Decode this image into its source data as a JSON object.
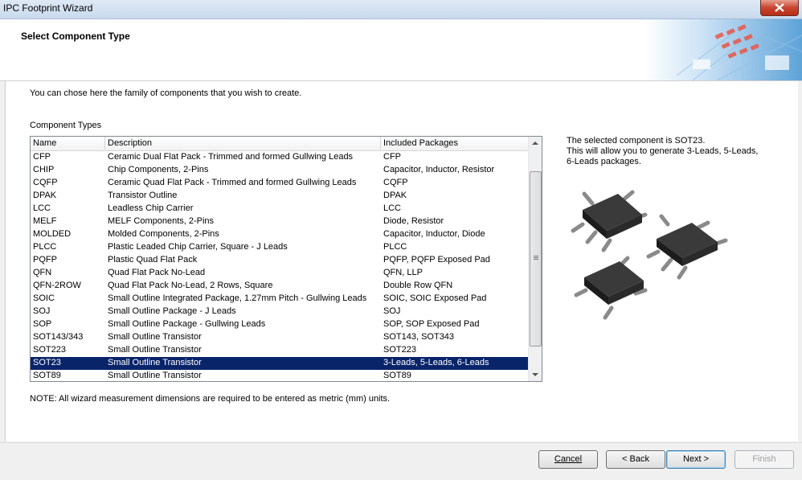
{
  "window": {
    "title": "IPC Footprint Wizard"
  },
  "header": {
    "title": "Select Component Type"
  },
  "intro_text": "You can chose here the family of components that you wish to create.",
  "list_label": "Component Types",
  "columns": [
    "Name",
    "Description",
    "Included Packages"
  ],
  "rows": [
    {
      "name": "CFP",
      "description": "Ceramic Dual Flat Pack - Trimmed and formed Gullwing Leads",
      "packages": "CFP"
    },
    {
      "name": "CHIP",
      "description": "Chip Components, 2-Pins",
      "packages": "Capacitor, Inductor, Resistor"
    },
    {
      "name": "CQFP",
      "description": "Ceramic Quad Flat Pack - Trimmed and formed Gullwing Leads",
      "packages": "CQFP"
    },
    {
      "name": "DPAK",
      "description": "Transistor Outline",
      "packages": "DPAK"
    },
    {
      "name": "LCC",
      "description": "Leadless Chip Carrier",
      "packages": "LCC"
    },
    {
      "name": "MELF",
      "description": "MELF Components, 2-Pins",
      "packages": "Diode, Resistor"
    },
    {
      "name": "MOLDED",
      "description": "Molded Components, 2-Pins",
      "packages": "Capacitor, Inductor, Diode"
    },
    {
      "name": "PLCC",
      "description": "Plastic Leaded Chip Carrier, Square - J Leads",
      "packages": "PLCC"
    },
    {
      "name": "PQFP",
      "description": "Plastic Quad Flat Pack",
      "packages": "PQFP, PQFP Exposed Pad"
    },
    {
      "name": "QFN",
      "description": "Quad Flat Pack No-Lead",
      "packages": "QFN, LLP"
    },
    {
      "name": "QFN-2ROW",
      "description": "Quad Flat Pack No-Lead, 2 Rows, Square",
      "packages": "Double Row QFN"
    },
    {
      "name": "SOIC",
      "description": "Small Outline Integrated Package, 1.27mm Pitch - Gullwing Leads",
      "packages": "SOIC, SOIC Exposed Pad"
    },
    {
      "name": "SOJ",
      "description": "Small Outline Package - J Leads",
      "packages": "SOJ"
    },
    {
      "name": "SOP",
      "description": "Small Outline Package - Gullwing Leads",
      "packages": "SOP, SOP Exposed Pad"
    },
    {
      "name": "SOT143/343",
      "description": "Small Outline Transistor",
      "packages": "SOT143, SOT343"
    },
    {
      "name": "SOT223",
      "description": "Small Outline Transistor",
      "packages": "SOT223"
    },
    {
      "name": "SOT23",
      "description": "Small Outline Transistor",
      "packages": "3-Leads, 5-Leads, 6-Leads",
      "selected": true
    },
    {
      "name": "SOT89",
      "description": "Small Outline Transistor",
      "packages": "SOT89"
    }
  ],
  "info": {
    "line1": "The selected component is SOT23.",
    "line2": "This will allow you to generate 3-Leads, 5-Leads,",
    "line3": "6-Leads packages."
  },
  "note": "NOTE: All wizard measurement dimensions are required to be entered as metric (mm) units.",
  "buttons": {
    "cancel": "Cancel",
    "back": "< Back",
    "next": "Next >",
    "finish": "Finish"
  },
  "icons": {
    "close": "close-icon",
    "scroll_up": "scroll-up-arrow-icon",
    "scroll_down": "scroll-down-arrow-icon"
  },
  "colors": {
    "selection": "#0a246a",
    "close": "#c9452f"
  }
}
